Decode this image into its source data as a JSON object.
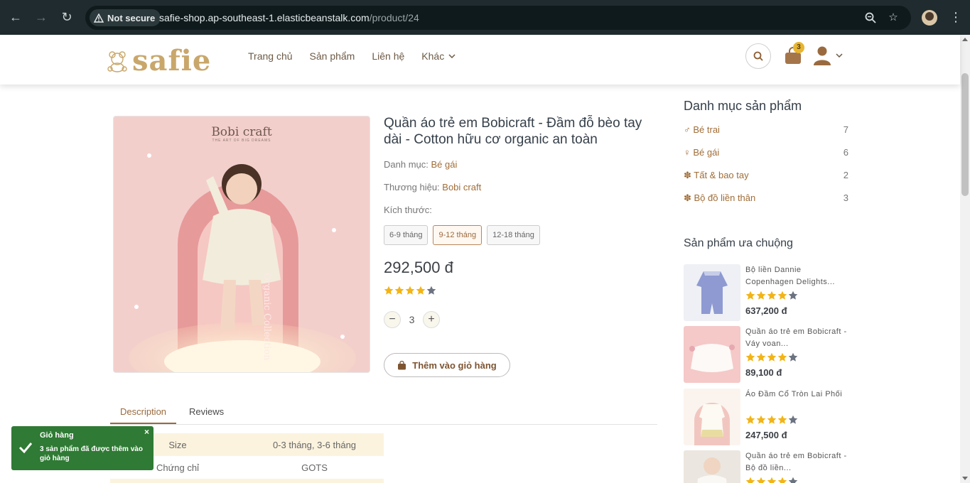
{
  "browser": {
    "security_label": "Not secure",
    "url_host": "safie-shop.ap-southeast-1.elasticbeanstalk.com",
    "url_path": "/product/24"
  },
  "header": {
    "logo_text": "safie",
    "menu": [
      "Trang chủ",
      "Sản phẩm",
      "Liên hệ",
      "Khác"
    ],
    "cart_count": "3",
    "accent_color": "#9a6a3e"
  },
  "product": {
    "image_brand": "Bobi craft",
    "image_tagline": "THE ART OF BIG DREAMS",
    "image_side_text": "Organic Collection",
    "title": "Quần áo trẻ em Bobicraft - Đầm đỗ bèo tay dài - Cotton hữu cơ organic an toàn",
    "category_label": "Danh mục: ",
    "category_value": "Bé gái",
    "brand_label": "Thương hiệu: ",
    "brand_value": "Bobi craft",
    "size_label": "Kích thước:",
    "sizes": [
      "6-9 tháng",
      "9-12 tháng",
      "12-18 tháng"
    ],
    "selected_size": "9-12 tháng",
    "price": "292,500 đ",
    "rating": 4,
    "rating_max": 5,
    "quantity": "3",
    "add_to_cart": "Thêm vào giỏ hàng"
  },
  "tabs": {
    "description": "Description",
    "reviews": "Reviews"
  },
  "specs": [
    {
      "key": "Size",
      "value": "0-3 tháng, 3-6 tháng"
    },
    {
      "key": "Chứng chỉ",
      "value": "GOTS"
    }
  ],
  "sidebar": {
    "categories_title": "Danh mục sản phẩm",
    "categories": [
      {
        "icon": "male-icon",
        "label": "Bé trai",
        "count": "7"
      },
      {
        "icon": "female-icon",
        "label": "Bé gái",
        "count": "6"
      },
      {
        "icon": "baby-icon",
        "label": "Tất & bao tay",
        "count": "2"
      },
      {
        "icon": "baby-icon",
        "label": "Bộ đồ liền thân",
        "count": "3"
      }
    ],
    "popular_title": "Sản phẩm ưa chuộng",
    "popular": [
      {
        "name": "Bộ liền Dannie Copenhagen Delights...",
        "rating": 4,
        "price": "637,200 đ"
      },
      {
        "name": "Quần áo trẻ em Bobicraft - Váy voan...",
        "rating": 4,
        "price": "89,100 đ"
      },
      {
        "name": "Áo Đầm Cổ Tròn Lai Phối",
        "rating": 4,
        "price": "247,500 đ"
      },
      {
        "name": "Quần áo trẻ em Bobicraft - Bộ đồ liền...",
        "rating": 4,
        "price": ""
      }
    ]
  },
  "toast": {
    "title": "Giỏ hàng",
    "message": "3 sản phẩm đã được thêm vào giỏ hàng",
    "close": "×",
    "color": "#2f7a34"
  }
}
